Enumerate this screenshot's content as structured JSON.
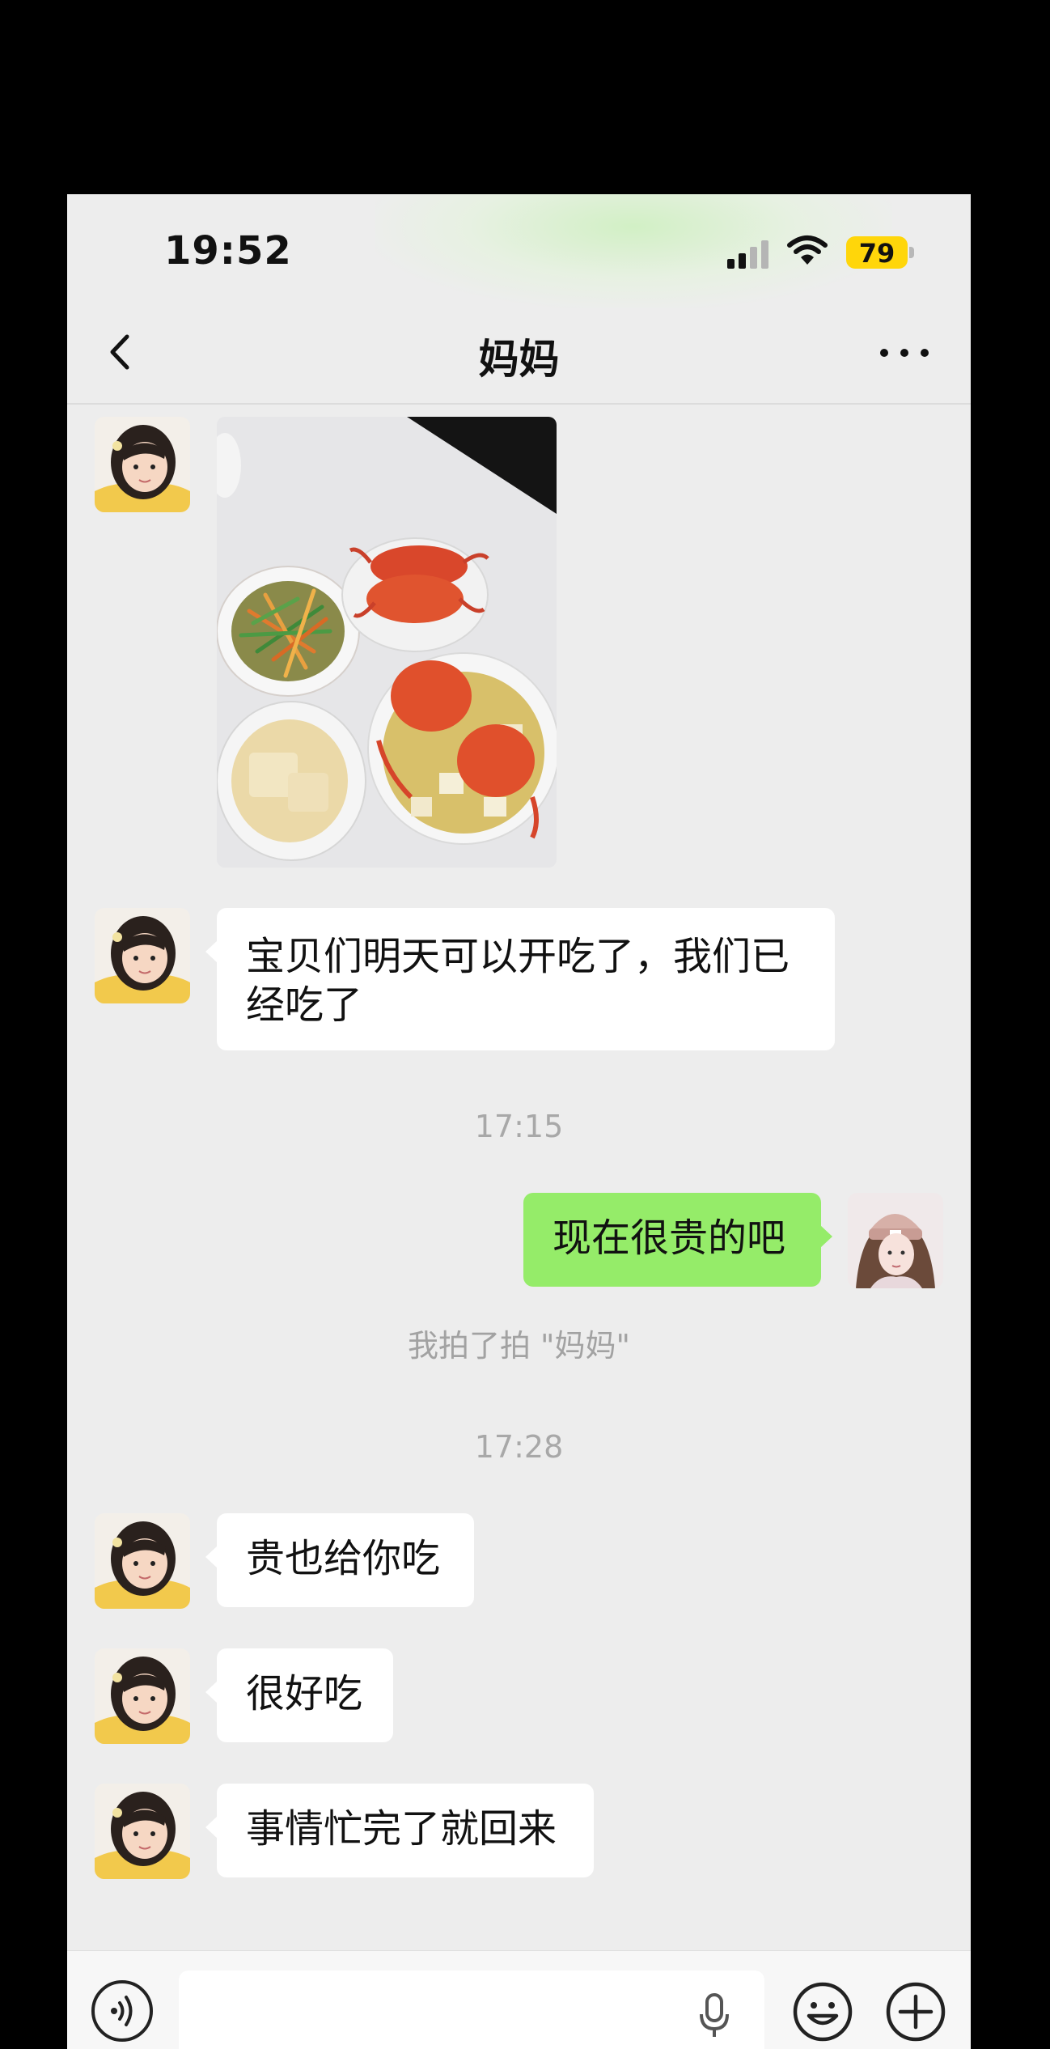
{
  "status_bar": {
    "time": "19:52",
    "battery_percent": "79",
    "battery_level": 0.79,
    "signal_bars_active": 2,
    "signal_bars_total": 4,
    "icons": [
      "signal-icon",
      "wifi-icon",
      "battery-icon"
    ],
    "battery_color": "#ffd60a"
  },
  "nav": {
    "title": "妈妈",
    "back_icon": "chevron-left-icon",
    "more_icon": "more-dots-icon"
  },
  "messages": [
    {
      "type": "image",
      "sender": "妈妈",
      "direction": "incoming",
      "icon": "food-photo"
    },
    {
      "type": "text",
      "sender": "妈妈",
      "direction": "incoming",
      "text": "宝贝们明天可以开吃了，我们已经吃了"
    },
    {
      "type": "timestamp",
      "text": "17:15"
    },
    {
      "type": "text",
      "sender": "me",
      "direction": "outgoing",
      "text": "现在很贵的吧"
    },
    {
      "type": "system",
      "text": "我拍了拍 \"妈妈\""
    },
    {
      "type": "timestamp",
      "text": "17:28"
    },
    {
      "type": "text",
      "sender": "妈妈",
      "direction": "incoming",
      "text": "贵也给你吃"
    },
    {
      "type": "text",
      "sender": "妈妈",
      "direction": "incoming",
      "text": "很好吃"
    },
    {
      "type": "text",
      "sender": "妈妈",
      "direction": "incoming",
      "text": "事情忙完了就回来"
    }
  ],
  "input_bar": {
    "placeholder": "",
    "icons": [
      "voice-icon",
      "mic-icon",
      "emoji-icon",
      "plus-icon"
    ]
  },
  "colors": {
    "background": "#ededed",
    "incoming_bubble": "#ffffff",
    "outgoing_bubble": "#95ec69",
    "timestamp_text": "#a8a8a8"
  }
}
